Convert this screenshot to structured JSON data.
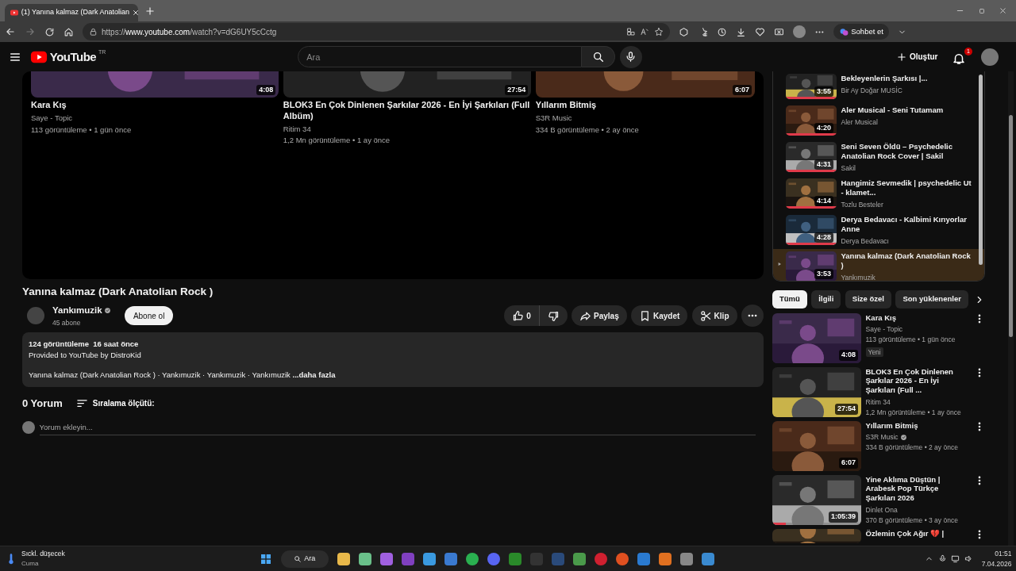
{
  "browser": {
    "tab_title": "(1) Yanına kalmaz (Dark Anatolian",
    "url_scheme": "https://",
    "url_host": "www.youtube.com",
    "url_path": "/watch?v=dG6UY5cCctg",
    "copilot": "Sohbet et"
  },
  "header": {
    "logo": "YouTube",
    "region": "TR",
    "search_placeholder": "Ara",
    "create": "Oluştur",
    "notifications": "1"
  },
  "end_screen": [
    {
      "duration": "4:08",
      "title": "Kara Kış",
      "channel": "Saye - Topic",
      "meta": "113 görüntüleme • 1 gün önce"
    },
    {
      "duration": "27:54",
      "title": "BLOK3 En Çok Dinlenen Şarkılar 2026 - En İyi Şarkıları (Full Albüm)",
      "channel": "Ritim 34",
      "meta": "1,2 Mn görüntüleme • 1 ay önce"
    },
    {
      "duration": "6:07",
      "title": "Yıllarım Bitmiş",
      "channel": "S3R Music",
      "meta": "334 B görüntüleme • 2 ay önce"
    }
  ],
  "video": {
    "title": "Yanına kalmaz (Dark Anatolian Rock )",
    "channel": "Yankımuzik",
    "verified": true,
    "subscribers": "45 abone",
    "subscribe": "Abone ol",
    "likes": "0",
    "actions": [
      "Paylaş",
      "Kaydet",
      "Klip"
    ]
  },
  "description": {
    "stats": "124 görüntüleme  16 saat önce",
    "lines": [
      "Provided to YouTube by DistroKid",
      "Yanına kalmaz (Dark Anatolian Rock ) · Yankımuzik · Yankımuzik · Yankımuzik"
    ],
    "more": "...daha fazla"
  },
  "comments": {
    "count": "0 Yorum",
    "sort": "Sıralama ölçütü:",
    "placeholder": "Yorum ekleyin..."
  },
  "playlist": [
    {
      "title": "Bekleyenlerin Şarkısı |...",
      "channel": "Bir Ay Doğar MUSİC",
      "duration": "3:55",
      "level": 1,
      "selected": false
    },
    {
      "title": "Aler Musical - Seni Tutamam",
      "channel": "Aler Musical",
      "duration": "4:20",
      "level": 1,
      "selected": false
    },
    {
      "title": "Seni Seven Öldü – Psychedelic Anatolian Rock Cover | Sakil",
      "channel": "Sakil",
      "duration": "4:31",
      "level": 1,
      "selected": false
    },
    {
      "title": "Hangimiz Sevmedik | psychedelic Ut - klamet...",
      "channel": "Tozlu Besteler",
      "duration": "4:14",
      "level": 1,
      "selected": false
    },
    {
      "title": "Derya Bedavacı - Kalbimi Kırıyorlar Anne",
      "channel": "Derya Bedavacı",
      "duration": "4:28",
      "level": 1,
      "selected": false
    },
    {
      "title": "Yanına kalmaz (Dark Anatolian Rock )",
      "channel": "Yankımuzik",
      "duration": "3:53",
      "selected": true
    }
  ],
  "chips": [
    {
      "label": "Tümü",
      "selected": true
    },
    {
      "label": "İlgili",
      "selected": false
    },
    {
      "label": "Size özel",
      "selected": false
    },
    {
      "label": "Son yüklenenler",
      "selected": false
    }
  ],
  "recommendations": [
    {
      "title": "Kara Kış",
      "channel": "Saye - Topic",
      "meta": "113 görüntüleme • 1 gün önce",
      "badge": "Yeni",
      "duration": "4:08"
    },
    {
      "title": "BLOK3 En Çok Dinlenen Şarkılar 2026 - En İyi Şarkıları (Full ...",
      "channel": "Ritim 34",
      "meta": "1,2 Mn görüntüleme • 1 ay önce",
      "duration": "27:54"
    },
    {
      "title": "Yıllarım Bitmiş",
      "channel": "S3R Music",
      "verified": true,
      "meta": "334 B görüntüleme • 2 ay önce",
      "duration": "6:07"
    },
    {
      "title": "Yine Aklıma Düştün | Arabesk Pop Türkçe Şarkıları 2026",
      "channel": "Dinlet Ona",
      "meta": "370 B görüntüleme • 3 ay önce",
      "duration": "1:05:39",
      "level": 0.15
    },
    {
      "title": "Özlemin Çok Ağır 💔 |"
    }
  ],
  "taskbar": {
    "weather": "Sıckl. düşecek",
    "day": "Cuma",
    "search": "Ara",
    "time": "01:51",
    "date": "7.04.2026"
  }
}
